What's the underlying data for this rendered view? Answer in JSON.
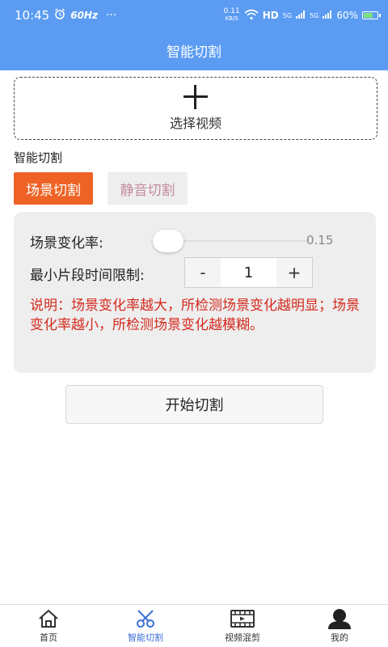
{
  "status_bar": {
    "time": "10:45",
    "refresh_rate": "60Hz",
    "dots": "···",
    "net_speed_value": "0.11",
    "net_speed_unit": "KB/S",
    "hd_label": "HD",
    "signal_1": "5G",
    "signal_2": "5G",
    "battery_percent": "60%",
    "battery_level": 0.6
  },
  "header": {
    "title": "智能切割"
  },
  "select_video": {
    "label": "选择视频"
  },
  "section": {
    "label": "智能切割"
  },
  "tabs": [
    {
      "label": "场景切割",
      "active": true
    },
    {
      "label": "静音切割",
      "active": false
    }
  ],
  "settings": {
    "rate_label": "场景变化率:",
    "rate_value": "0.15",
    "rate_fraction": 0.15,
    "min_label": "最小片段时间限制:",
    "min_value": "1",
    "decrement": "-",
    "increment": "+",
    "note": "说明：场景变化率越大，所检测场景变化越明显；场景变化率越小，所检测场景变化越模糊。"
  },
  "start_button": {
    "label": "开始切割"
  },
  "nav": [
    {
      "label": "首页",
      "icon": "home-icon",
      "active": false
    },
    {
      "label": "智能切割",
      "icon": "scissors-icon",
      "active": true
    },
    {
      "label": "视频混剪",
      "icon": "film-icon",
      "active": false
    },
    {
      "label": "我的",
      "icon": "user-icon",
      "active": false
    }
  ],
  "colors": {
    "primary": "#5b9cf2",
    "tab_active": "#ee6325",
    "tab_inactive_text": "#c38b9b",
    "note_text": "#d42a1e",
    "nav_active": "#3b6fd6"
  }
}
